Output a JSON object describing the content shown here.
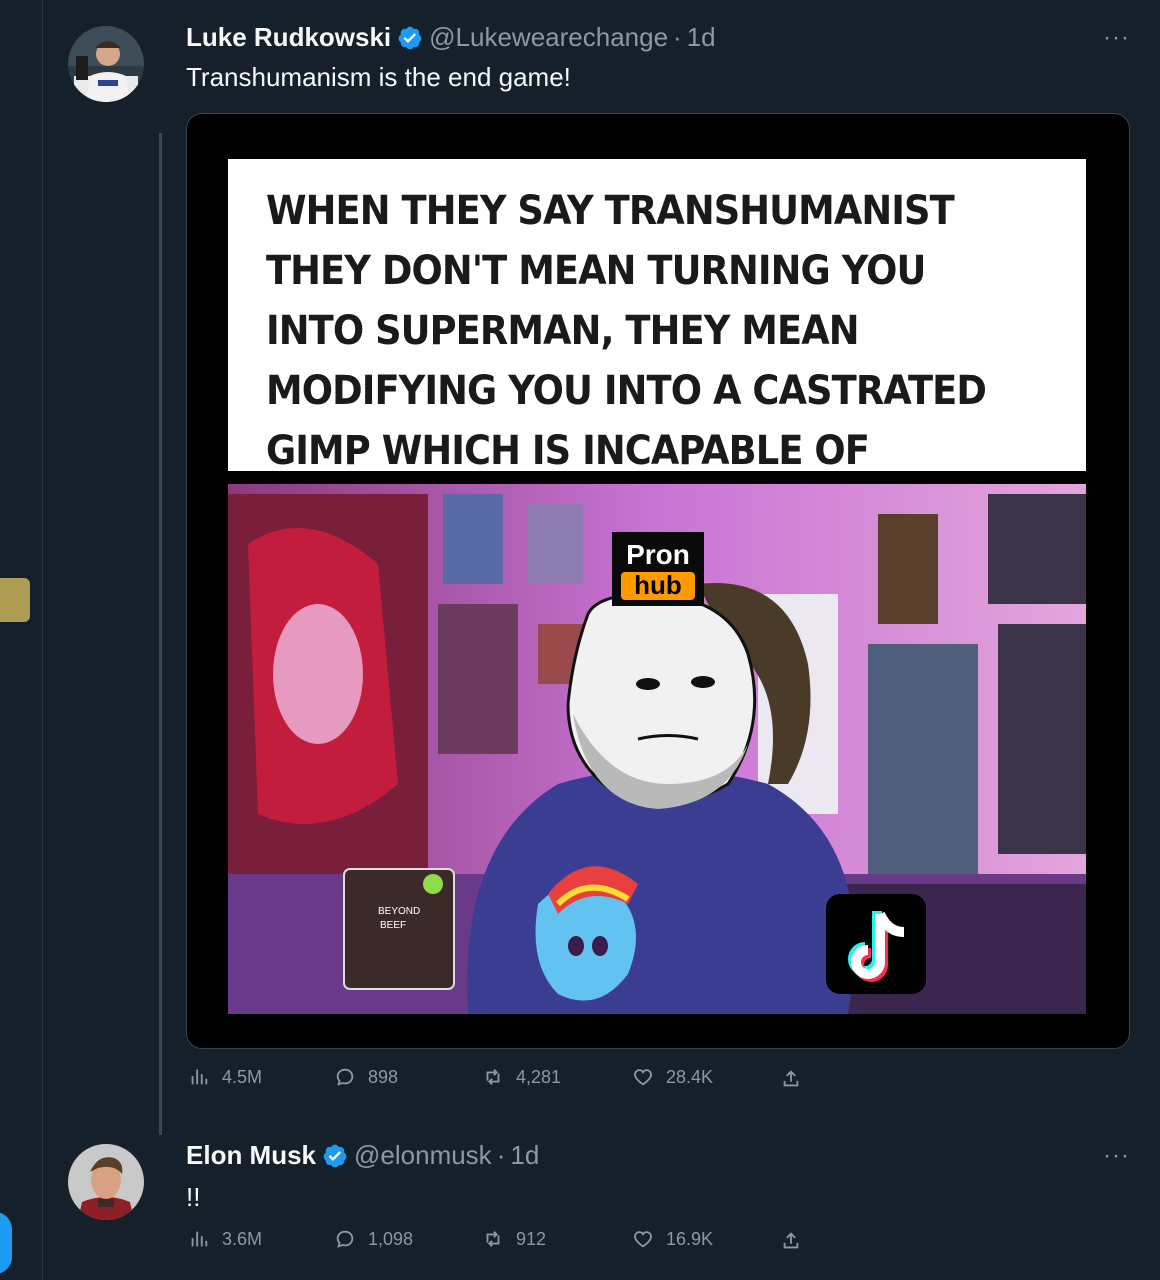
{
  "tweet1": {
    "name": "Luke Rudkowski",
    "handle": "@Lukewearechange",
    "time": "1d",
    "text": "Transhumanism is the end game!",
    "more_label": "···",
    "media": {
      "caption": "WHEN THEY SAY TRANSHUMANIST THEY DON'T MEAN TURNING YOU INTO SUPERMAN, THEY MEAN MODIFYING YOU INTO A CASTRATED GIMP WHICH IS INCAPABLE OF REBELLION.",
      "logo_line1": "Pron",
      "logo_line2": "hub",
      "package_line1": "BEYOND",
      "package_line2": "BEEF"
    },
    "views": "4.5M",
    "replies": "898",
    "retweets": "4,281",
    "likes": "28.4K"
  },
  "tweet2": {
    "name": "Elon Musk",
    "handle": "@elonmusk",
    "time": "1d",
    "text": "!!",
    "more_label": "···",
    "views": "3.6M",
    "replies": "1,098",
    "retweets": "912",
    "likes": "16.9K"
  },
  "colors": {
    "background": "#15202b",
    "primary_text": "#f7f9f9",
    "secondary_text": "#8b98a5",
    "verified": "#1d9bf0"
  },
  "icons": [
    "verified-badge-icon",
    "more-icon",
    "views-icon",
    "reply-icon",
    "retweet-icon",
    "like-icon",
    "share-icon"
  ]
}
